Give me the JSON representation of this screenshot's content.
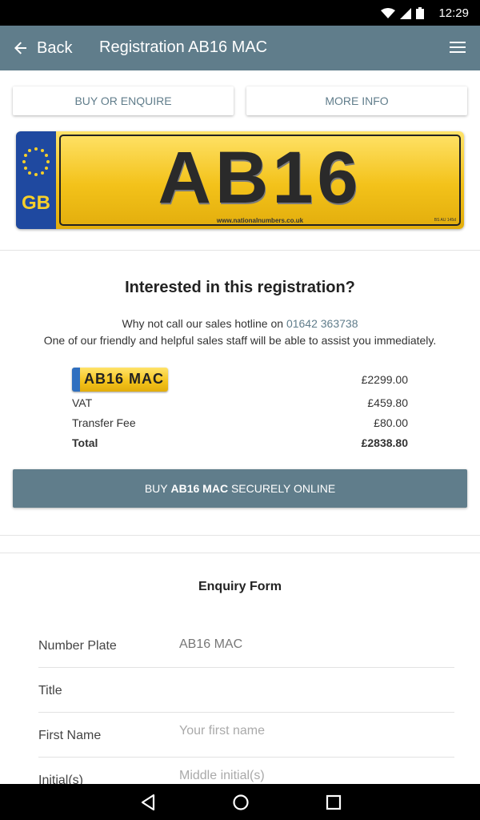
{
  "status_bar": {
    "time": "12:29"
  },
  "app_bar": {
    "back_label": "Back",
    "title": "Registration AB16 MAC"
  },
  "actions": {
    "buy_or_enquire": "BUY OR ENQUIRE",
    "more_info": "MORE INFO"
  },
  "plate": {
    "registration": "AB16 MAC",
    "country": "GB",
    "website": "www.nationalnumbers.co.uk",
    "code": "BS AU 145d"
  },
  "interest": {
    "heading": "Interested in this registration?",
    "hotline_prefix": "Why not call our sales hotline on",
    "hotline_number": "01642 363738",
    "assist_text": "One of our friendly and helpful sales staff will be able to assist you immediately."
  },
  "prices": {
    "plate_text": "AB16 MAC",
    "plate_price": "£2299.00",
    "vat_label": "VAT",
    "vat_value": "£459.80",
    "transfer_label": "Transfer Fee",
    "transfer_value": "£80.00",
    "total_label": "Total",
    "total_value": "£2838.80"
  },
  "buy_button": {
    "prefix": "BUY",
    "reg": "AB16 MAC",
    "suffix": "SECURELY ONLINE"
  },
  "enquiry": {
    "title": "Enquiry Form",
    "number_plate_label": "Number Plate",
    "number_plate_value": "AB16 MAC",
    "title_label": "Title",
    "first_name_label": "First Name",
    "first_name_placeholder": "Your first name",
    "initials_label": "Initial(s)",
    "initials_placeholder": "Middle initial(s)"
  },
  "colors": {
    "app_bar": "#607d8b",
    "accent_link": "#607d8b",
    "plate_yellow": "#f3c21a",
    "eu_blue": "#1f49a0"
  },
  "icons": [
    "wifi-icon",
    "signal-icon",
    "battery-icon",
    "back-arrow-icon",
    "hamburger-menu-icon",
    "eu-stars-icon",
    "nav-back-icon",
    "nav-home-icon",
    "nav-recents-icon"
  ]
}
